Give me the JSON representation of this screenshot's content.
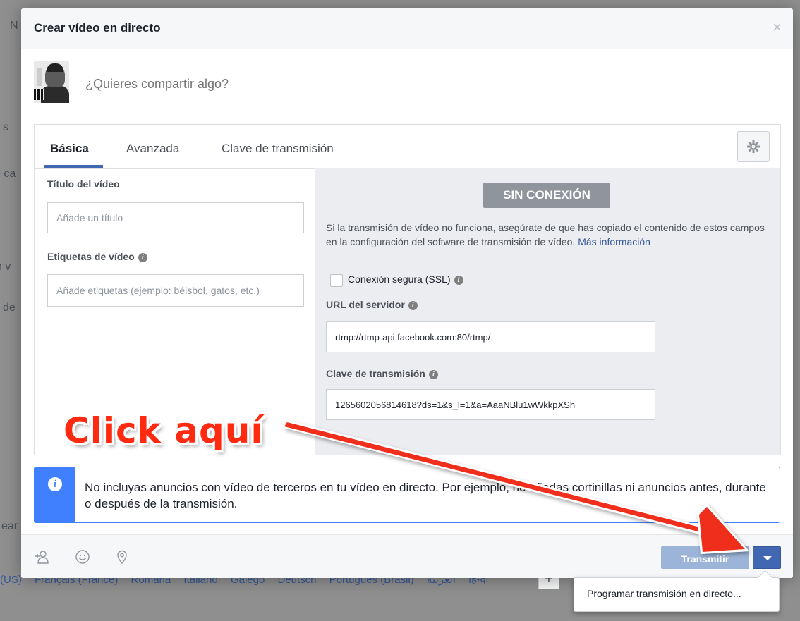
{
  "background": {
    "fragments": [
      "N",
      "s",
      "e ca",
      "n v",
      "de",
      "ear"
    ],
    "languages": [
      "(US)",
      "Français (France)",
      "Română",
      "Italiano",
      "Galego",
      "Deutsch",
      "Português (Brasil)",
      "العربية",
      "हिन्दी"
    ],
    "plus_label": "+"
  },
  "dialog": {
    "title": "Crear vídeo en directo",
    "close_label": "×",
    "composer_placeholder": "¿Quieres compartir algo?",
    "tabs": [
      "Básica",
      "Avanzada",
      "Clave de transmisión"
    ],
    "video_title_label": "Título del vídeo",
    "video_title_placeholder": "Añade un título",
    "video_tags_label": "Etiquetas de vídeo",
    "video_tags_placeholder": "Añade etiquetas (ejemplo: béisbol, gatos, etc.)",
    "status_badge": "SIN CONEXIÓN",
    "help_text": "Si la transmisión de vídeo no funciona, asegúrate de que has copiado el contenido de estos campos en la configuración del software de transmisión de vídeo.",
    "help_link": "Más información",
    "ssl_label": "Conexión segura (SSL)",
    "server_url_label": "URL del servidor",
    "server_url_value": "rtmp://rtmp-api.facebook.com:80/rtmp/",
    "stream_key_label": "Clave de transmisión",
    "stream_key_value": "1265602056814618?ds=1&s_l=1&a=AaaNBlu1wWkkpXSh",
    "notice_text": "No incluyas anuncios con vídeo de terceros en tu vídeo en directo. Por ejemplo, no añadas cortinillas ni anuncios antes, durante o después de la transmisión.",
    "transmit_label": "Transmitir",
    "menu_item": "Programar transmisión en directo..."
  },
  "icons": {
    "tag_friends": "tag-friends-icon",
    "emoji": "emoji-icon",
    "location": "location-icon",
    "gear": "gear-icon",
    "info": "info-icon"
  },
  "annotation": {
    "text": "Click aquí"
  },
  "colors": {
    "accent": "#4267b2",
    "notice_border": "#4080ff",
    "annotation": "#ff2a10",
    "offline_badge": "#90949c"
  }
}
